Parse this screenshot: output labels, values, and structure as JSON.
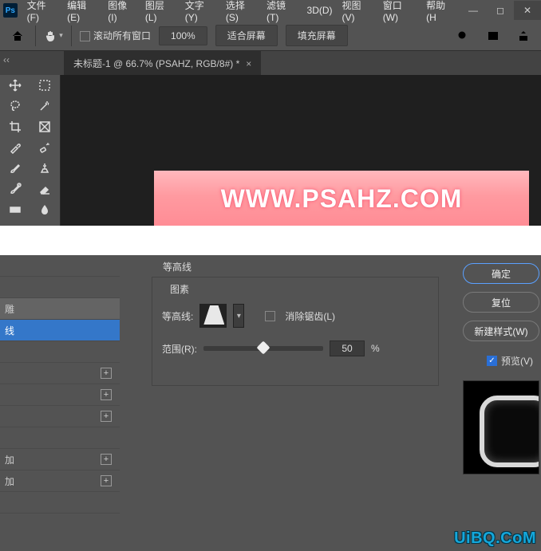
{
  "menubar": {
    "items": [
      "文件(F)",
      "编辑(E)",
      "图像(I)",
      "图层(L)",
      "文字(Y)",
      "选择(S)",
      "滤镜(T)",
      "3D(D)",
      "视图(V)",
      "窗口(W)",
      "帮助(H"
    ]
  },
  "optionsbar": {
    "scroll_all_label": "滚动所有窗口",
    "zoom_value": "100%",
    "fit_screen": "适合屏幕",
    "fill_screen": "填充屏幕"
  },
  "document": {
    "tab_title": "未标题-1 @ 66.7% (PSAHZ, RGB/8#) *",
    "close_glyph": "×",
    "watermark": "WWW.PSAHZ.COM"
  },
  "layerstyle": {
    "group_title": "等高线",
    "subgroup_title": "图素",
    "contour_label": "等高线:",
    "antialias_label": "消除锯齿(L)",
    "range_label": "范围(R):",
    "range_value": "50",
    "range_unit": "%",
    "left_items": [
      {
        "label": "",
        "plus": false
      },
      {
        "label": "",
        "plus": false
      },
      {
        "label": "雕",
        "plus": false
      },
      {
        "label": "线",
        "plus": false,
        "selected": true
      },
      {
        "label": "",
        "plus": false
      },
      {
        "label": "",
        "plus": true
      },
      {
        "label": "",
        "plus": true
      },
      {
        "label": "",
        "plus": true
      },
      {
        "label": "",
        "plus": false
      },
      {
        "label": "加",
        "plus": true
      },
      {
        "label": "加",
        "plus": true
      },
      {
        "label": "",
        "plus": false
      }
    ],
    "buttons": {
      "ok": "确定",
      "cancel": "复位",
      "new_style": "新建样式(W)",
      "preview": "预览(V)"
    }
  },
  "site_watermark": "UiBQ.CoM"
}
